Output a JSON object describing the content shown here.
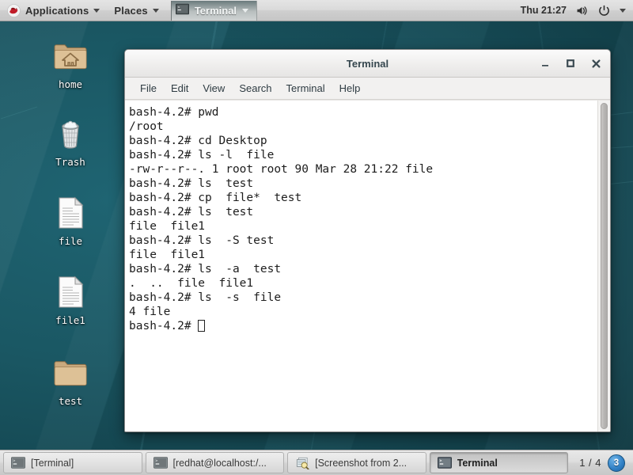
{
  "top_panel": {
    "logo": "redhat-logo",
    "applications_label": "Applications",
    "places_label": "Places",
    "window_item_label": "Terminal",
    "clock": "Thu 21:27",
    "volume_icon": "volume-icon",
    "power_icon": "power-icon",
    "dropdown_icon": "chevron-down-icon"
  },
  "desktop": {
    "icons": [
      {
        "label": "home",
        "type": "folder-home"
      },
      {
        "label": "Trash",
        "type": "trash"
      },
      {
        "label": "file",
        "type": "document"
      },
      {
        "label": "file1",
        "type": "document"
      },
      {
        "label": "test",
        "type": "folder"
      }
    ]
  },
  "terminal": {
    "title": "Terminal",
    "minimize_label": "_",
    "maximize_label": "□",
    "close_label": "×",
    "menu": [
      "File",
      "Edit",
      "View",
      "Search",
      "Terminal",
      "Help"
    ],
    "lines": [
      "bash-4.2# pwd",
      "/root",
      "bash-4.2# cd Desktop",
      "bash-4.2# ls -l  file",
      "-rw-r--r--. 1 root root 90 Mar 28 21:22 file",
      "bash-4.2# ls  test",
      "bash-4.2# cp  file*  test",
      "bash-4.2# ls  test",
      "file  file1",
      "bash-4.2# ls  -S test",
      "file  file1",
      "bash-4.2# ls  -a  test",
      ".  ..  file  file1",
      "bash-4.2# ls  -s  file",
      "4 file"
    ],
    "prompt": "bash-4.2# "
  },
  "bottom_panel": {
    "tasks": [
      {
        "label": "[Terminal]",
        "icon": "terminal-icon",
        "active": false
      },
      {
        "label": "[redhat@localhost:/...",
        "icon": "terminal-icon",
        "active": false
      },
      {
        "label": "[Screenshot from 2...",
        "icon": "screenshot-icon",
        "active": false
      },
      {
        "label": "Terminal",
        "icon": "terminal-icon",
        "active": true
      }
    ],
    "workspace_count": "1 / 4",
    "notification_count": "3"
  },
  "colors": {
    "desktop_bg": "#1a5763",
    "panel_bg": "#dadada",
    "terminal_bg": "#ffffff",
    "terminal_fg": "#1d1d1d",
    "title_fg": "#36474f",
    "badge_blue": "#2f7fc4"
  }
}
